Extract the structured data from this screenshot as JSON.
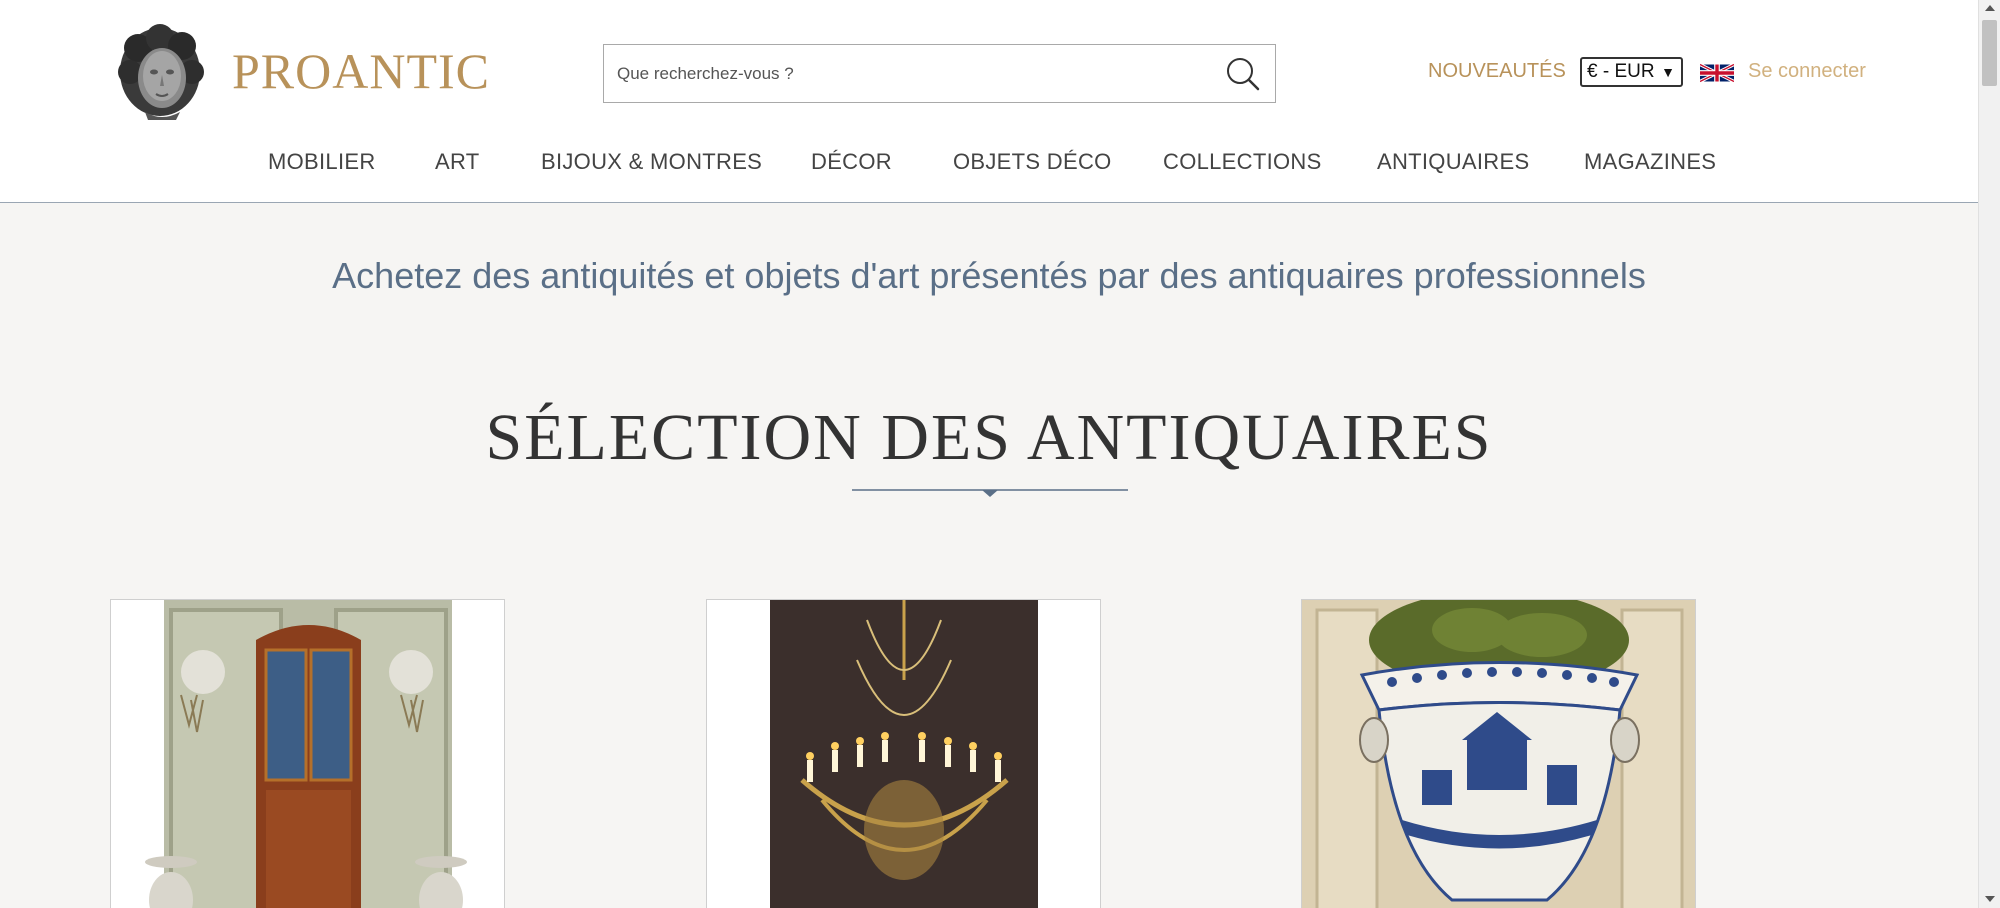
{
  "header": {
    "logo_text": "PROANTIC",
    "search_placeholder": "Que recherchez-vous ?",
    "nouveautes_label": "NOUVEAUTÉS",
    "currency_value": "€ - EUR",
    "login_label": "Se connecter"
  },
  "nav": {
    "items": [
      {
        "label": "MOBILIER"
      },
      {
        "label": "ART"
      },
      {
        "label": "BIJOUX & MONTRES"
      },
      {
        "label": "DÉCOR"
      },
      {
        "label": "OBJETS DÉCO"
      },
      {
        "label": "COLLECTIONS"
      },
      {
        "label": "ANTIQUAIRES"
      },
      {
        "label": "MAGAZINES"
      }
    ]
  },
  "main": {
    "tagline": "Achetez des antiquités et objets d'art présentés par des antiquaires professionnels",
    "section_title": "SÉLECTION DES ANTIQUAIRES"
  },
  "colors": {
    "brand_gold": "#b8925a",
    "login_gold": "#d1b17f",
    "tagline_blue": "#5a6f87",
    "background": "#f6f5f3"
  },
  "icons": {
    "search": "search-icon",
    "flag": "uk-flag-icon",
    "logo": "logo-bust-icon"
  }
}
